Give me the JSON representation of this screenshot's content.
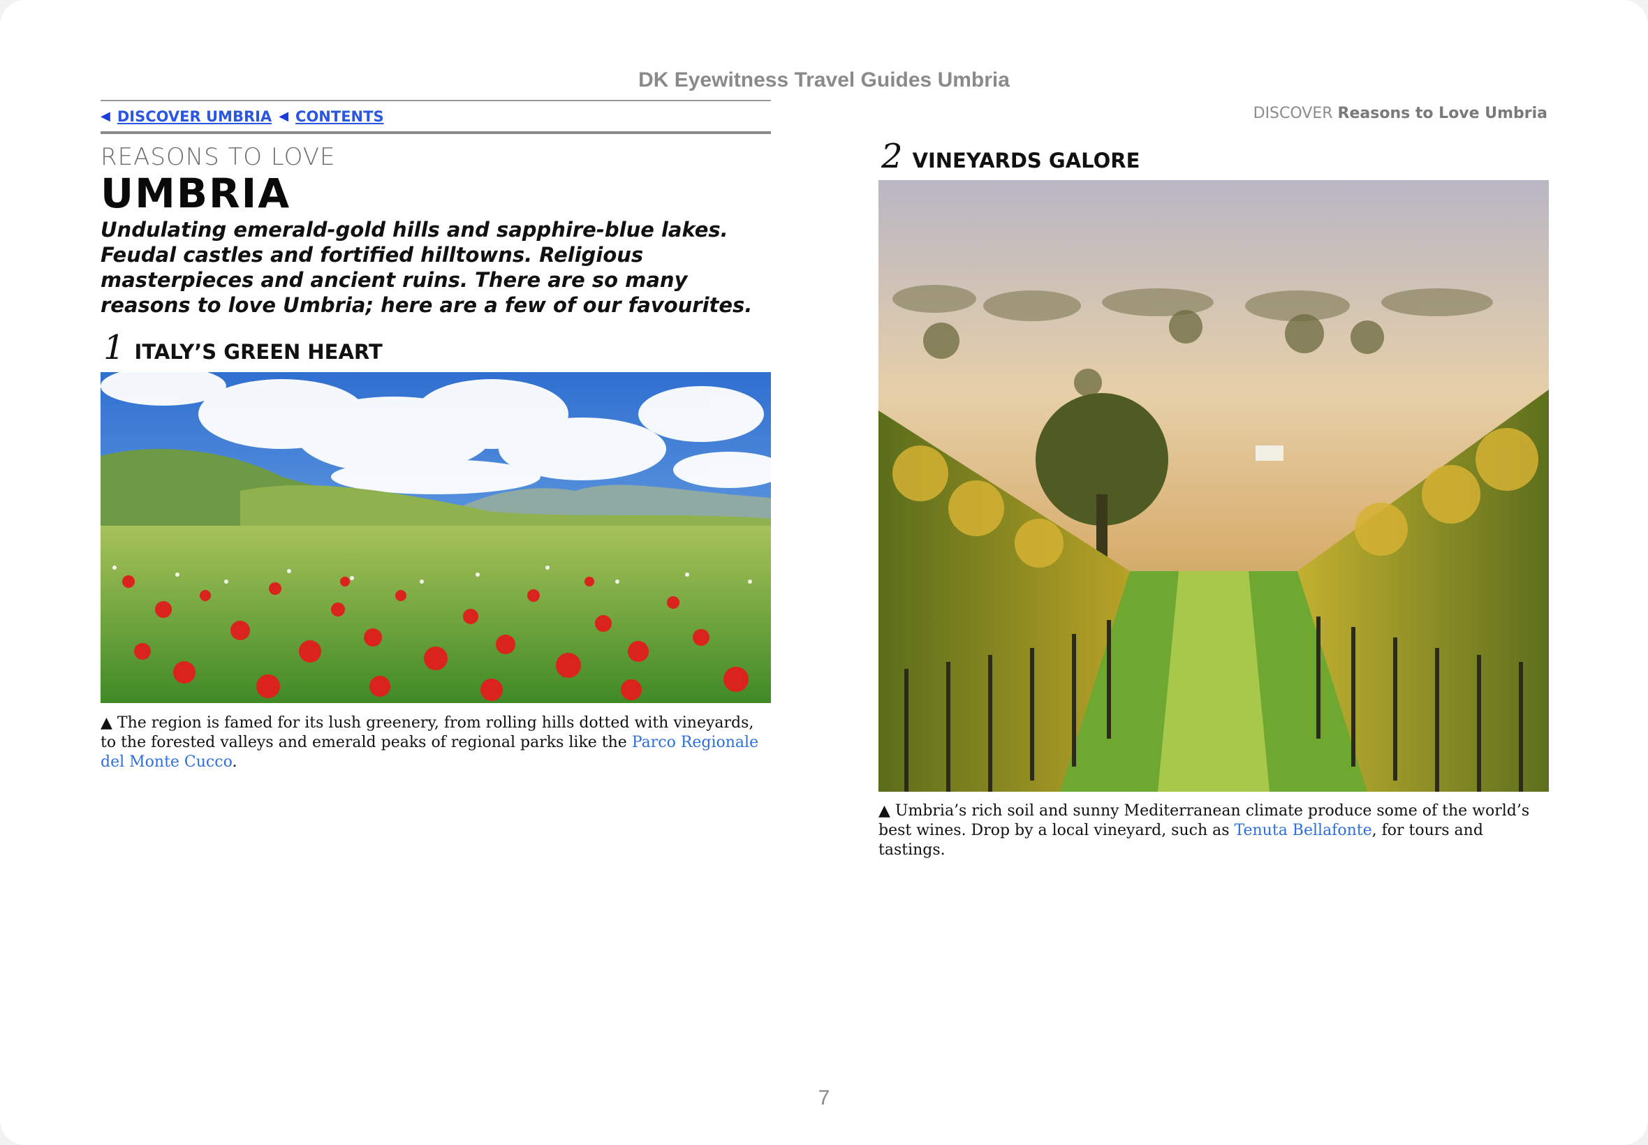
{
  "book_title": "DK Eyewitness Travel Guides Umbria",
  "nav": {
    "discover_label": "DISCOVER UMBRIA",
    "contents_label": "CONTENTS",
    "arrow": "◀"
  },
  "running_head": {
    "section": "DISCOVER",
    "title": "Reasons to Love Umbria"
  },
  "kicker": "REASONS TO LOVE",
  "title": "UMBRIA",
  "intro": "Undulating emerald-gold hills and sapphire-blue lakes. Feudal castles and fortified hilltowns. Religious masterpieces and ancient ruins. There are so many reasons to love Umbria; here are a few of our favourites.",
  "sections": [
    {
      "number": "1",
      "heading": "ITALY’S GREEN HEART",
      "caption_prefix": "▲ The region is famed for its lush greenery, from rolling hills dotted with vineyards, to the forested valleys and emerald peaks of regional parks like the ",
      "caption_link": "Parco Regionale del Monte Cucco",
      "caption_suffix": "."
    },
    {
      "number": "2",
      "heading": "VINEYARDS GALORE",
      "caption_prefix": "▲ Umbria’s rich soil and sunny Mediterranean climate produce some of the world’s best wines. Drop by a local vineyard, such as ",
      "caption_link": "Tenuta Bellafonte",
      "caption_suffix": ", for tours and tastings."
    }
  ],
  "page_number": "7",
  "colors": {
    "link": "#2f6fdc",
    "nav_link": "#2b57e0",
    "muted_text": "#8a8a8a"
  }
}
